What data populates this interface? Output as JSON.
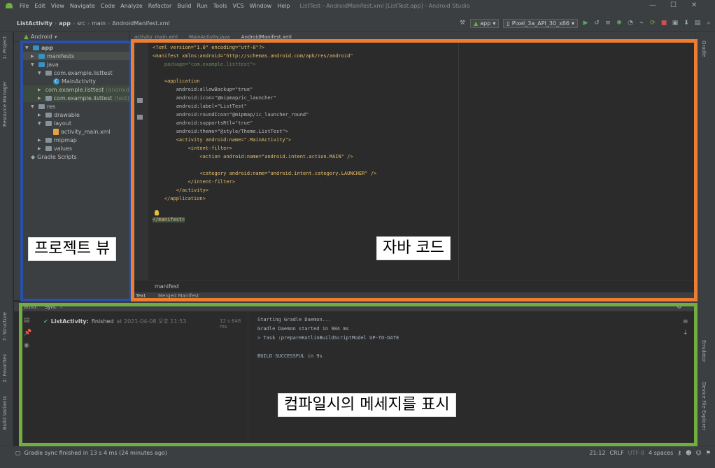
{
  "window": {
    "menu": [
      "File",
      "Edit",
      "View",
      "Navigate",
      "Code",
      "Analyze",
      "Refactor",
      "Build",
      "Run",
      "Tools",
      "VCS",
      "Window",
      "Help"
    ],
    "title": "ListTest - AndroidManifest.xml [ListTest.app] - Android Studio"
  },
  "breadcrumbs": [
    "ListActivity",
    "app",
    "src",
    "main",
    "AndroidManifest.xml"
  ],
  "toolbar": {
    "run_config": "app",
    "device": "Pixel_3a_API_30_x86"
  },
  "left_stripe": {
    "project_tab": "1: Project",
    "resource_tab": "Resource Manager",
    "structure_tab": "7: Structure",
    "favorites_tab": "2: Favorites",
    "variants_tab": "Build Variants"
  },
  "right_stripe": {
    "gradle_tab": "Gradle",
    "emulator_tab": "Emulator",
    "device_explorer_tab": "Device File Explorer"
  },
  "project": {
    "view_selector": "Android",
    "tree": [
      {
        "label": "app",
        "type": "module",
        "expanded": true
      },
      {
        "label": "manifests",
        "type": "folder",
        "selected": true
      },
      {
        "label": "java",
        "type": "folder",
        "expanded": true
      },
      {
        "label": "com.example.listtest",
        "type": "package"
      },
      {
        "label": "MainActivity",
        "type": "class"
      },
      {
        "label": "com.example.listtest",
        "suffix": "(androidTest)",
        "type": "package"
      },
      {
        "label": "com.example.listtest",
        "suffix": "(test)",
        "type": "package"
      },
      {
        "label": "res",
        "type": "folder",
        "expanded": true
      },
      {
        "label": "drawable",
        "type": "folder"
      },
      {
        "label": "layout",
        "type": "folder",
        "expanded": true
      },
      {
        "label": "activity_main.xml",
        "type": "file"
      },
      {
        "label": "mipmap",
        "type": "folder"
      },
      {
        "label": "values",
        "type": "folder"
      },
      {
        "label": "Gradle Scripts",
        "type": "gradle"
      }
    ]
  },
  "editor": {
    "tabs": [
      "activity_main.xml",
      "MainActivity.java",
      "AndroidManifest.xml"
    ],
    "code": [
      "<?xml version=\"1.0\" encoding=\"utf-8\"?>",
      "<manifest xmlns:android=\"http://schemas.android.com/apk/res/android\"",
      "    package=\"com.example.listtest\">",
      "",
      "    <application",
      "        android:allowBackup=\"true\"",
      "        android:icon=\"@mipmap/ic_launcher\"",
      "        android:label=\"ListTest\"",
      "        android:roundIcon=\"@mipmap/ic_launcher_round\"",
      "        android:supportsRtl=\"true\"",
      "        android:theme=\"@style/Theme.ListTest\">",
      "        <activity android:name=\".MainActivity\">",
      "            <intent-filter>",
      "                <action android:name=\"android.intent.action.MAIN\" />",
      "",
      "                <category android:name=\"android.intent.category.LAUNCHER\" />",
      "            </intent-filter>",
      "        </activity>",
      "    </application>",
      "",
      "</manifest>"
    ],
    "breadcrumb": "manifest",
    "bottom_tabs": [
      "Text",
      "Merged Manifest"
    ]
  },
  "build": {
    "tab_build": "Build:",
    "tab_sync": "Sync",
    "result_label": "ListActivity:",
    "result_status": "finished",
    "result_time": "at 2021-04-08 오후 11:53",
    "duration": "12 s 648 ms",
    "output": [
      "Starting Gradle Daemon...",
      "Gradle Daemon started in 984 ms",
      "> Task :prepareKotlinBuildScriptModel UP-TO-DATE",
      "",
      "BUILD SUCCESSFUL in 9s"
    ]
  },
  "status": {
    "message": "Gradle sync finished in 13 s 4 ms (24 minutes ago)",
    "position": "21:12",
    "line_sep": "CRLF",
    "encoding": "UTF-8",
    "indent": "4 spaces"
  },
  "annotations": {
    "project_view": "프로젝트 뷰",
    "code": "자바 코드",
    "build_messages": "컴파일시의 메세지를 표시",
    "colors": {
      "project": "#2850a8",
      "editor": "#ed7d31",
      "build": "#6fae3f"
    }
  }
}
